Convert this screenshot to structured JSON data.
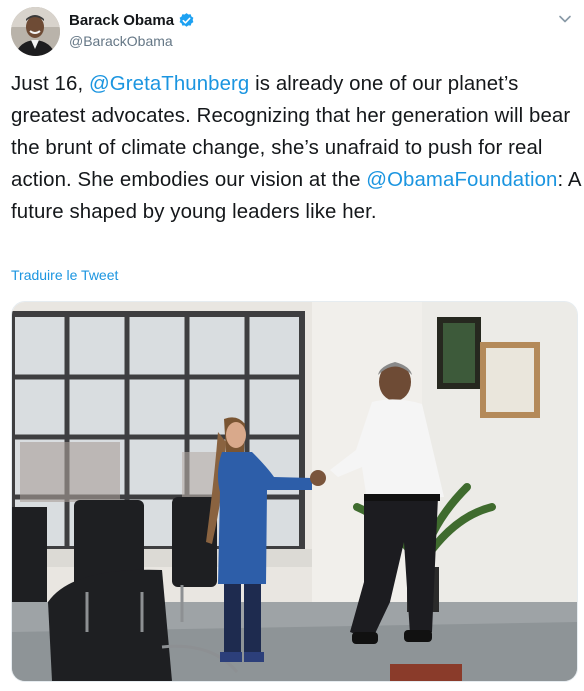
{
  "author": {
    "display_name": "Barack Obama",
    "handle": "@BarackObama",
    "verified": true,
    "avatar_icon": "profile-photo"
  },
  "menu": {
    "icon": "chevron-down-icon"
  },
  "tweet": {
    "segments": [
      {
        "type": "text",
        "value": "Just 16, "
      },
      {
        "type": "mention",
        "value": "@GretaThunberg"
      },
      {
        "type": "text",
        "value": " is already one of our planet’s greatest advocates. Recognizing that her generation will bear the brunt of climate change, she’s unafraid to push for real action. She embodies our vision at the "
      },
      {
        "type": "mention",
        "value": "@ObamaFoundation"
      },
      {
        "type": "text",
        "value": ": A future shaped by young leaders like her."
      }
    ]
  },
  "translate_label": "Traduire le Tweet",
  "colors": {
    "link": "#1b95e0",
    "text": "#14171a",
    "secondary": "#657786",
    "verified": "#1da1f2"
  }
}
